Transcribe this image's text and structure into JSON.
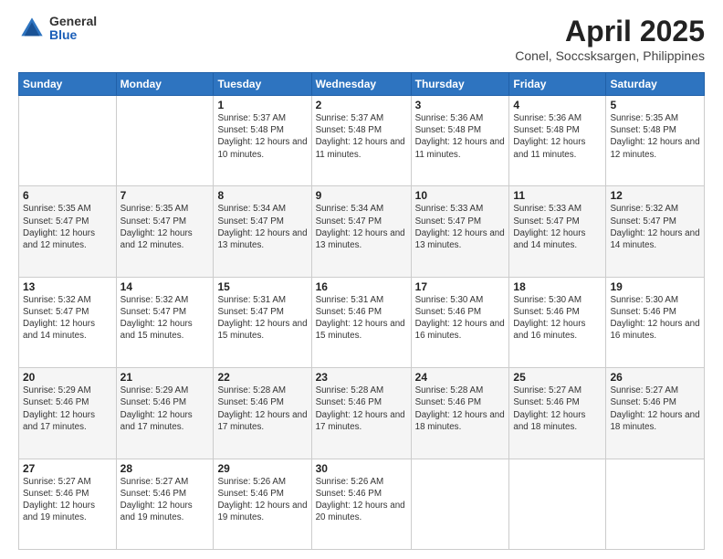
{
  "logo": {
    "general": "General",
    "blue": "Blue"
  },
  "title": "April 2025",
  "subtitle": "Conel, Soccsksargen, Philippines",
  "days_header": [
    "Sunday",
    "Monday",
    "Tuesday",
    "Wednesday",
    "Thursday",
    "Friday",
    "Saturday"
  ],
  "weeks": [
    [
      {
        "day": "",
        "sunrise": "",
        "sunset": "",
        "daylight": ""
      },
      {
        "day": "",
        "sunrise": "",
        "sunset": "",
        "daylight": ""
      },
      {
        "day": "1",
        "sunrise": "Sunrise: 5:37 AM",
        "sunset": "Sunset: 5:48 PM",
        "daylight": "Daylight: 12 hours and 10 minutes."
      },
      {
        "day": "2",
        "sunrise": "Sunrise: 5:37 AM",
        "sunset": "Sunset: 5:48 PM",
        "daylight": "Daylight: 12 hours and 11 minutes."
      },
      {
        "day": "3",
        "sunrise": "Sunrise: 5:36 AM",
        "sunset": "Sunset: 5:48 PM",
        "daylight": "Daylight: 12 hours and 11 minutes."
      },
      {
        "day": "4",
        "sunrise": "Sunrise: 5:36 AM",
        "sunset": "Sunset: 5:48 PM",
        "daylight": "Daylight: 12 hours and 11 minutes."
      },
      {
        "day": "5",
        "sunrise": "Sunrise: 5:35 AM",
        "sunset": "Sunset: 5:48 PM",
        "daylight": "Daylight: 12 hours and 12 minutes."
      }
    ],
    [
      {
        "day": "6",
        "sunrise": "Sunrise: 5:35 AM",
        "sunset": "Sunset: 5:47 PM",
        "daylight": "Daylight: 12 hours and 12 minutes."
      },
      {
        "day": "7",
        "sunrise": "Sunrise: 5:35 AM",
        "sunset": "Sunset: 5:47 PM",
        "daylight": "Daylight: 12 hours and 12 minutes."
      },
      {
        "day": "8",
        "sunrise": "Sunrise: 5:34 AM",
        "sunset": "Sunset: 5:47 PM",
        "daylight": "Daylight: 12 hours and 13 minutes."
      },
      {
        "day": "9",
        "sunrise": "Sunrise: 5:34 AM",
        "sunset": "Sunset: 5:47 PM",
        "daylight": "Daylight: 12 hours and 13 minutes."
      },
      {
        "day": "10",
        "sunrise": "Sunrise: 5:33 AM",
        "sunset": "Sunset: 5:47 PM",
        "daylight": "Daylight: 12 hours and 13 minutes."
      },
      {
        "day": "11",
        "sunrise": "Sunrise: 5:33 AM",
        "sunset": "Sunset: 5:47 PM",
        "daylight": "Daylight: 12 hours and 14 minutes."
      },
      {
        "day": "12",
        "sunrise": "Sunrise: 5:32 AM",
        "sunset": "Sunset: 5:47 PM",
        "daylight": "Daylight: 12 hours and 14 minutes."
      }
    ],
    [
      {
        "day": "13",
        "sunrise": "Sunrise: 5:32 AM",
        "sunset": "Sunset: 5:47 PM",
        "daylight": "Daylight: 12 hours and 14 minutes."
      },
      {
        "day": "14",
        "sunrise": "Sunrise: 5:32 AM",
        "sunset": "Sunset: 5:47 PM",
        "daylight": "Daylight: 12 hours and 15 minutes."
      },
      {
        "day": "15",
        "sunrise": "Sunrise: 5:31 AM",
        "sunset": "Sunset: 5:47 PM",
        "daylight": "Daylight: 12 hours and 15 minutes."
      },
      {
        "day": "16",
        "sunrise": "Sunrise: 5:31 AM",
        "sunset": "Sunset: 5:46 PM",
        "daylight": "Daylight: 12 hours and 15 minutes."
      },
      {
        "day": "17",
        "sunrise": "Sunrise: 5:30 AM",
        "sunset": "Sunset: 5:46 PM",
        "daylight": "Daylight: 12 hours and 16 minutes."
      },
      {
        "day": "18",
        "sunrise": "Sunrise: 5:30 AM",
        "sunset": "Sunset: 5:46 PM",
        "daylight": "Daylight: 12 hours and 16 minutes."
      },
      {
        "day": "19",
        "sunrise": "Sunrise: 5:30 AM",
        "sunset": "Sunset: 5:46 PM",
        "daylight": "Daylight: 12 hours and 16 minutes."
      }
    ],
    [
      {
        "day": "20",
        "sunrise": "Sunrise: 5:29 AM",
        "sunset": "Sunset: 5:46 PM",
        "daylight": "Daylight: 12 hours and 17 minutes."
      },
      {
        "day": "21",
        "sunrise": "Sunrise: 5:29 AM",
        "sunset": "Sunset: 5:46 PM",
        "daylight": "Daylight: 12 hours and 17 minutes."
      },
      {
        "day": "22",
        "sunrise": "Sunrise: 5:28 AM",
        "sunset": "Sunset: 5:46 PM",
        "daylight": "Daylight: 12 hours and 17 minutes."
      },
      {
        "day": "23",
        "sunrise": "Sunrise: 5:28 AM",
        "sunset": "Sunset: 5:46 PM",
        "daylight": "Daylight: 12 hours and 17 minutes."
      },
      {
        "day": "24",
        "sunrise": "Sunrise: 5:28 AM",
        "sunset": "Sunset: 5:46 PM",
        "daylight": "Daylight: 12 hours and 18 minutes."
      },
      {
        "day": "25",
        "sunrise": "Sunrise: 5:27 AM",
        "sunset": "Sunset: 5:46 PM",
        "daylight": "Daylight: 12 hours and 18 minutes."
      },
      {
        "day": "26",
        "sunrise": "Sunrise: 5:27 AM",
        "sunset": "Sunset: 5:46 PM",
        "daylight": "Daylight: 12 hours and 18 minutes."
      }
    ],
    [
      {
        "day": "27",
        "sunrise": "Sunrise: 5:27 AM",
        "sunset": "Sunset: 5:46 PM",
        "daylight": "Daylight: 12 hours and 19 minutes."
      },
      {
        "day": "28",
        "sunrise": "Sunrise: 5:27 AM",
        "sunset": "Sunset: 5:46 PM",
        "daylight": "Daylight: 12 hours and 19 minutes."
      },
      {
        "day": "29",
        "sunrise": "Sunrise: 5:26 AM",
        "sunset": "Sunset: 5:46 PM",
        "daylight": "Daylight: 12 hours and 19 minutes."
      },
      {
        "day": "30",
        "sunrise": "Sunrise: 5:26 AM",
        "sunset": "Sunset: 5:46 PM",
        "daylight": "Daylight: 12 hours and 20 minutes."
      },
      {
        "day": "",
        "sunrise": "",
        "sunset": "",
        "daylight": ""
      },
      {
        "day": "",
        "sunrise": "",
        "sunset": "",
        "daylight": ""
      },
      {
        "day": "",
        "sunrise": "",
        "sunset": "",
        "daylight": ""
      }
    ]
  ]
}
